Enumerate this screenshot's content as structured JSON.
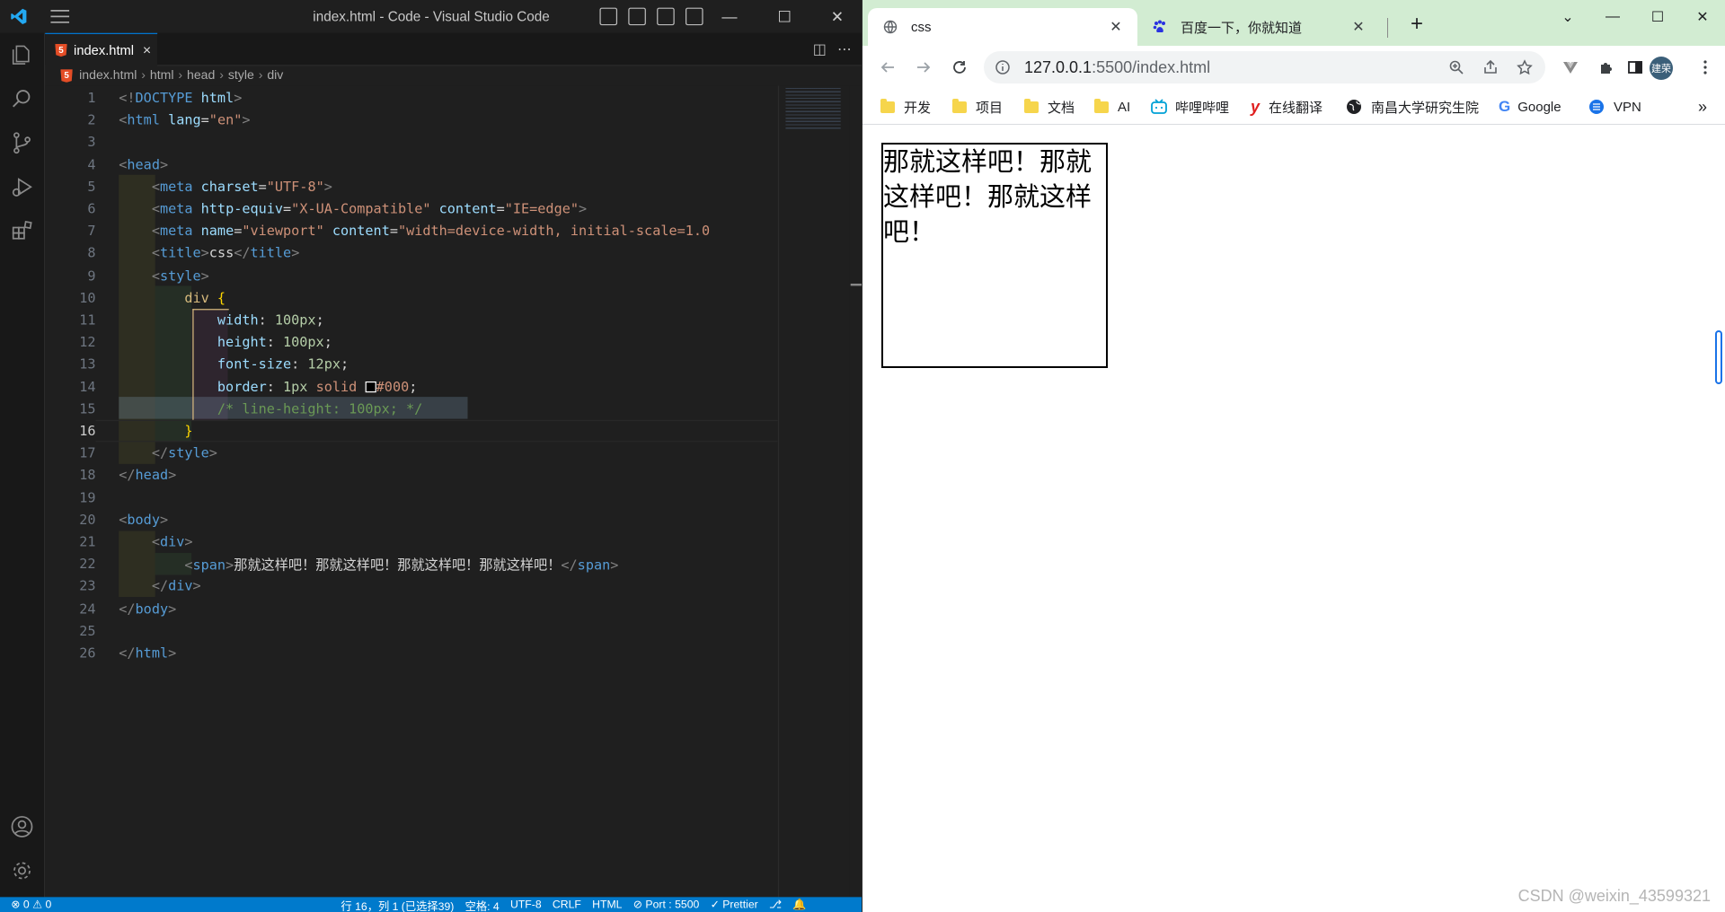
{
  "vscode": {
    "window_title": "index.html - Code - Visual Studio Code",
    "tab": {
      "filename": "index.html",
      "close": "×"
    },
    "breadcrumb": [
      "index.html",
      "html",
      "head",
      "style",
      "div"
    ],
    "cursor_line": "16",
    "code_lines": [
      {
        "n": "1",
        "html": "<span class='t-tag'>&lt;!</span><span class='t-name'>DOCTYPE</span> <span class='t-attr'>html</span><span class='t-tag'>&gt;</span>"
      },
      {
        "n": "2",
        "html": "<span class='t-tag'>&lt;</span><span class='t-name'>html</span> <span class='t-attr'>lang</span><span class='t-txt'>=</span><span class='t-str'>\"en\"</span><span class='t-tag'>&gt;</span>"
      },
      {
        "n": "3",
        "html": ""
      },
      {
        "n": "4",
        "html": "<span class='t-tag'>&lt;</span><span class='t-name'>head</span><span class='t-tag'>&gt;</span>"
      },
      {
        "n": "5",
        "html": "    <span class='t-tag'>&lt;</span><span class='t-name'>meta</span> <span class='t-attr'>charset</span><span class='t-txt'>=</span><span class='t-str'>\"UTF-8\"</span><span class='t-tag'>&gt;</span>"
      },
      {
        "n": "6",
        "html": "    <span class='t-tag'>&lt;</span><span class='t-name'>meta</span> <span class='t-attr'>http-equiv</span><span class='t-txt'>=</span><span class='t-str'>\"X-UA-Compatible\"</span> <span class='t-attr'>content</span><span class='t-txt'>=</span><span class='t-str'>\"IE=edge\"</span><span class='t-tag'>&gt;</span>"
      },
      {
        "n": "7",
        "html": "    <span class='t-tag'>&lt;</span><span class='t-name'>meta</span> <span class='t-attr'>name</span><span class='t-txt'>=</span><span class='t-str'>\"viewport\"</span> <span class='t-attr'>content</span><span class='t-txt'>=</span><span class='t-str'>\"width=device-width, initial-scale=1.0</span>"
      },
      {
        "n": "8",
        "html": "    <span class='t-tag'>&lt;</span><span class='t-name'>title</span><span class='t-tag'>&gt;</span><span class='t-txt'>css</span><span class='t-tag'>&lt;/</span><span class='t-name'>title</span><span class='t-tag'>&gt;</span>"
      },
      {
        "n": "9",
        "html": "    <span class='t-tag'>&lt;</span><span class='t-name'>style</span><span class='t-tag'>&gt;</span>"
      },
      {
        "n": "10",
        "html": "        <span class='t-sel'>div</span> <span class='t-brace'>{</span>"
      },
      {
        "n": "11",
        "html": "            <span class='t-prop'>width</span><span class='t-txt'>: </span><span class='t-num'>100px</span><span class='t-txt'>;</span>"
      },
      {
        "n": "12",
        "html": "            <span class='t-prop'>height</span><span class='t-txt'>: </span><span class='t-num'>100px</span><span class='t-txt'>;</span>"
      },
      {
        "n": "13",
        "html": "            <span class='t-prop'>font-size</span><span class='t-txt'>: </span><span class='t-num'>12px</span><span class='t-txt'>;</span>"
      },
      {
        "n": "14",
        "html": "            <span class='t-prop'>border</span><span class='t-txt'>: </span><span class='t-num'>1px</span> <span class='t-str'>solid</span> <span style='display:inline-block;width:10px;height:10px;border:1px solid #fff;background:#000;vertical-align:-1px'></span><span class='t-str'>#000</span><span class='t-txt'>;</span>"
      },
      {
        "n": "15",
        "html": "            <span class='t-cmt'>/* line-height: 100px; */</span>"
      },
      {
        "n": "16",
        "html": "        <span class='t-brace'>}</span>"
      },
      {
        "n": "17",
        "html": "    <span class='t-tag'>&lt;/</span><span class='t-name'>style</span><span class='t-tag'>&gt;</span>"
      },
      {
        "n": "18",
        "html": "<span class='t-tag'>&lt;/</span><span class='t-name'>head</span><span class='t-tag'>&gt;</span>"
      },
      {
        "n": "19",
        "html": ""
      },
      {
        "n": "20",
        "html": "<span class='t-tag'>&lt;</span><span class='t-name'>body</span><span class='t-tag'>&gt;</span>"
      },
      {
        "n": "21",
        "html": "    <span class='t-tag'>&lt;</span><span class='t-name'>div</span><span class='t-tag'>&gt;</span>"
      },
      {
        "n": "22",
        "html": "        <span class='t-tag'>&lt;</span><span class='t-name'>span</span><span class='t-tag'>&gt;</span><span class='t-txt'>那就这样吧！那就这样吧！那就这样吧！那就这样吧！</span><span class='t-tag'>&lt;/</span><span class='t-name'>span</span><span class='t-tag'>&gt;</span>"
      },
      {
        "n": "23",
        "html": "    <span class='t-tag'>&lt;/</span><span class='t-name'>div</span><span class='t-tag'>&gt;</span>"
      },
      {
        "n": "24",
        "html": "<span class='t-tag'>&lt;/</span><span class='t-name'>body</span><span class='t-tag'>&gt;</span>"
      },
      {
        "n": "25",
        "html": ""
      },
      {
        "n": "26",
        "html": "<span class='t-tag'>&lt;/</span><span class='t-name'>html</span><span class='t-tag'>&gt;</span>"
      }
    ],
    "status": {
      "problems": "⊗ 0 ⚠ 0",
      "position": "行 16，列 1 (已选择39)",
      "spaces": "空格: 4",
      "encoding": "UTF-8",
      "eol": "CRLF",
      "language": "HTML",
      "port": "⊘ Port : 5500",
      "formatter": "✓ Prettier"
    }
  },
  "chrome": {
    "tabs": [
      {
        "title": "css",
        "active": true
      },
      {
        "title": "百度一下，你就知道",
        "active": false
      }
    ],
    "new_tab": "+",
    "url_host": "127.0.0.1",
    "url_rest": ":5500/index.html",
    "avatar": "建荣",
    "bookmarks": [
      {
        "label": "开发",
        "icon": "folder-icon"
      },
      {
        "label": "项目",
        "icon": "folder-icon"
      },
      {
        "label": "文档",
        "icon": "folder-icon"
      },
      {
        "label": "AI",
        "icon": "folder-icon"
      },
      {
        "label": "哔哩哔哩",
        "icon": "bilibili-icon"
      },
      {
        "label": "在线翻译",
        "icon": "youdao-icon"
      },
      {
        "label": "南昌大学研究生院",
        "icon": "globe-icon"
      },
      {
        "label": "Google",
        "icon": "google-icon"
      },
      {
        "label": "VPN",
        "icon": "vpn-icon"
      }
    ],
    "more_bookmarks": "»",
    "page_text": "那就这样吧！那就这样吧！那就这样吧！",
    "watermark": "CSDN @weixin_43599321"
  }
}
